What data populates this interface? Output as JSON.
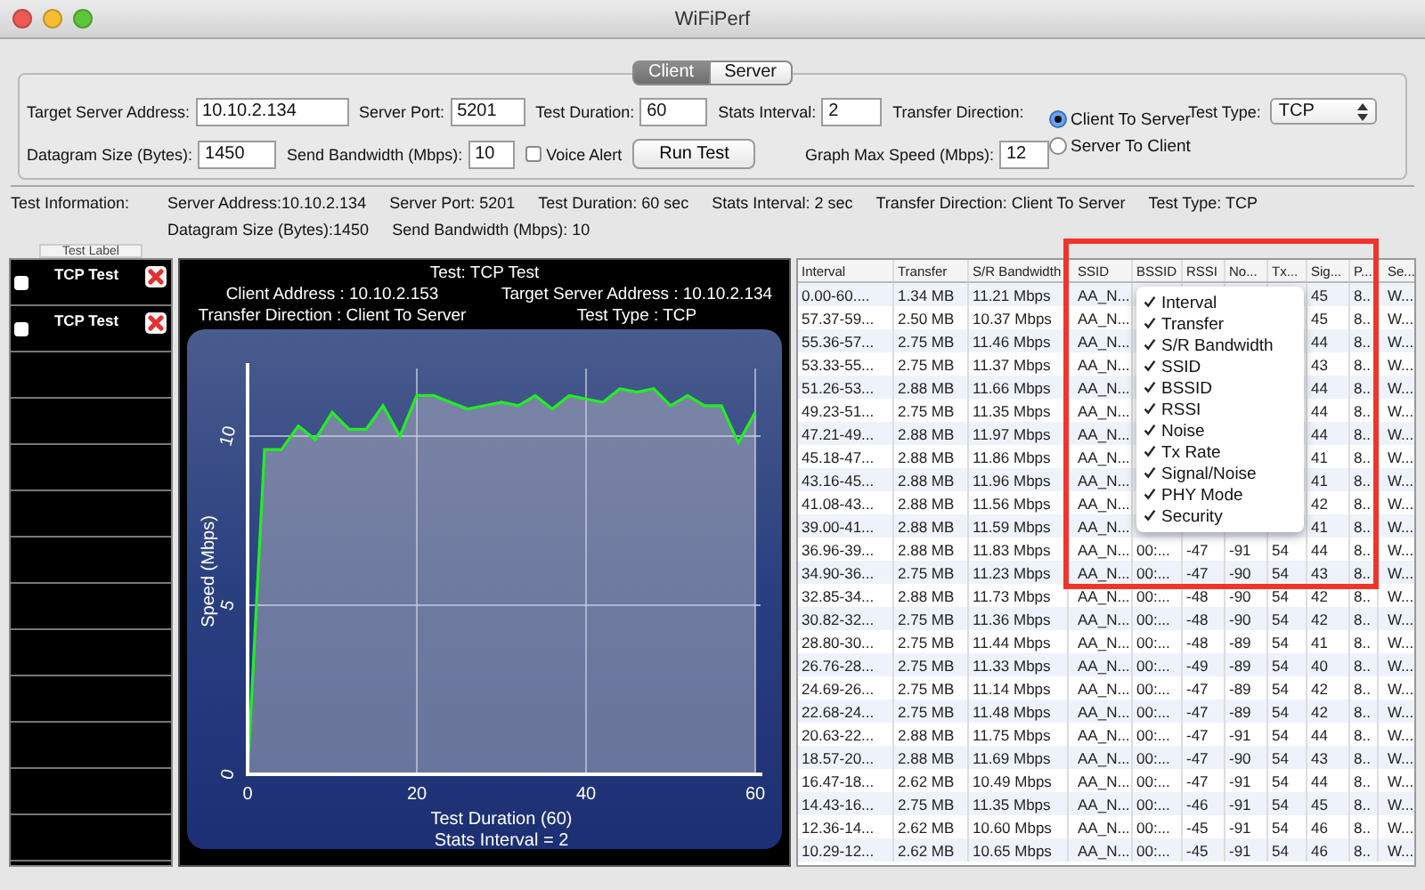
{
  "window": {
    "title": "WiFiPerf"
  },
  "tabs": [
    {
      "label": "Client",
      "selected": true
    },
    {
      "label": "Server",
      "selected": false
    }
  ],
  "form": {
    "row_1": [
      {
        "kind": "field",
        "label": "Target Server Address:",
        "value": "10.10.2.134"
      },
      {
        "kind": "field",
        "label": "Server Port:",
        "value": "5201"
      },
      {
        "kind": "field",
        "label": "Test Duration:",
        "value": "60"
      },
      {
        "kind": "field",
        "label": "Stats Interval:",
        "value": "2"
      }
    ],
    "transfer_direction": {
      "label": "Transfer Direction:",
      "options": [
        {
          "label": "Client To Server",
          "selected": true
        },
        {
          "label": "Server To Client",
          "selected": false
        }
      ]
    },
    "test_type": {
      "label": "Test Type:",
      "value": "TCP"
    },
    "row_2": [
      {
        "kind": "field",
        "label": "Datagram Size (Bytes):",
        "value": "1450"
      },
      {
        "kind": "field",
        "label": "Send Bandwidth (Mbps):",
        "value": "10"
      },
      {
        "kind": "checkbox",
        "label": "Voice Alert",
        "checked": false
      },
      {
        "kind": "button",
        "label": "Run Test"
      },
      {
        "kind": "field",
        "label": "Graph Max Speed (Mbps):",
        "value": "12"
      }
    ]
  },
  "test_information": {
    "label": "Test Information:",
    "lines": [
      [
        "Server Address:10.10.2.134",
        "Server Port: 5201",
        "Test Duration: 60 sec",
        "Stats Interval: 2 sec",
        "Transfer Direction: Client To Server",
        "Test Type: TCP"
      ],
      [
        "Datagram Size (Bytes):1450",
        "Send Bandwidth (Mbps): 10"
      ]
    ]
  },
  "tests": {
    "header": "Test Label",
    "items": [
      {
        "label": "TCP Test",
        "checked": false
      },
      {
        "label": "TCP Test",
        "checked": false
      }
    ]
  },
  "chart_header": {
    "title": "Test: TCP Test",
    "lines": [
      [
        "Client Address : 10.10.2.153",
        "Target Server Address : 10.10.2.134"
      ],
      [
        "Transfer Direction : Client To Server",
        "Test Type : TCP"
      ]
    ]
  },
  "chart_data": {
    "type": "line",
    "xlabel": "Test Duration (60)",
    "ylabel": "Speed (Mbps)",
    "annotations": [
      "Stats Interval = 2"
    ],
    "x": [
      0,
      2,
      4,
      6,
      8,
      10,
      12,
      14,
      16,
      18,
      20,
      22,
      24,
      26,
      28,
      30,
      32,
      34,
      36,
      38,
      40,
      42,
      44,
      46,
      48,
      50,
      52,
      54,
      56,
      58,
      60
    ],
    "series": [
      {
        "color": "#22ee22",
        "values": [
          0,
          9.6,
          9.6,
          10.3,
          9.9,
          10.7,
          10.2,
          10.2,
          10.9,
          10.0,
          11.2,
          11.2,
          11.0,
          10.8,
          10.9,
          11.0,
          10.9,
          11.2,
          10.8,
          11.2,
          11.1,
          11.0,
          11.4,
          11.3,
          11.4,
          10.9,
          11.2,
          10.9,
          10.9,
          9.8,
          10.7
        ]
      }
    ],
    "xlim": [
      0,
      60
    ],
    "ylim": [
      0,
      12
    ],
    "xticks": [
      0,
      20,
      40,
      60
    ],
    "yticks": [
      0,
      5,
      10
    ],
    "grid": true
  },
  "table": {
    "columns": [
      "Interval",
      "Transfer",
      "S/R Bandwidth",
      "SSID",
      "BSSID",
      "RSSI",
      "No...",
      "Tx...",
      "Sig...",
      "P...",
      "Se..."
    ],
    "rows": [
      [
        "0.00-60....",
        "1.34 MB",
        "11.21 Mbps",
        "AA_N...",
        null,
        null,
        null,
        null,
        "45",
        "8..",
        "W..."
      ],
      [
        "57.37-59...",
        "2.50 MB",
        "10.37 Mbps",
        "AA_N...",
        null,
        null,
        null,
        null,
        "45",
        "8..",
        "W..."
      ],
      [
        "55.36-57...",
        "2.75 MB",
        "11.46 Mbps",
        "AA_N...",
        null,
        null,
        null,
        null,
        "44",
        "8..",
        "W..."
      ],
      [
        "53.33-55...",
        "2.75 MB",
        "11.37 Mbps",
        "AA_N...",
        null,
        null,
        null,
        null,
        "43",
        "8..",
        "W..."
      ],
      [
        "51.26-53...",
        "2.88 MB",
        "11.66 Mbps",
        "AA_N...",
        null,
        null,
        null,
        null,
        "44",
        "8..",
        "W..."
      ],
      [
        "49.23-51...",
        "2.75 MB",
        "11.35 Mbps",
        "AA_N...",
        null,
        null,
        null,
        null,
        "44",
        "8..",
        "W..."
      ],
      [
        "47.21-49...",
        "2.88 MB",
        "11.97 Mbps",
        "AA_N...",
        null,
        null,
        null,
        null,
        "44",
        "8..",
        "W..."
      ],
      [
        "45.18-47...",
        "2.88 MB",
        "11.86 Mbps",
        "AA_N...",
        null,
        null,
        null,
        null,
        "41",
        "8..",
        "W..."
      ],
      [
        "43.16-45...",
        "2.88 MB",
        "11.96 Mbps",
        "AA_N...",
        null,
        null,
        null,
        null,
        "41",
        "8..",
        "W..."
      ],
      [
        "41.08-43...",
        "2.88 MB",
        "11.56 Mbps",
        "AA_N...",
        null,
        null,
        null,
        null,
        "42",
        "8..",
        "W..."
      ],
      [
        "39.00-41...",
        "2.88 MB",
        "11.59 Mbps",
        "AA_N...",
        null,
        null,
        null,
        null,
        "41",
        "8..",
        "W..."
      ],
      [
        "36.96-39...",
        "2.88 MB",
        "11.83 Mbps",
        "AA_N...",
        "00:...",
        "-47",
        "-91",
        "54",
        "44",
        "8..",
        "W..."
      ],
      [
        "34.90-36...",
        "2.75 MB",
        "11.23 Mbps",
        "AA_N...",
        "00:...",
        "-47",
        "-90",
        "54",
        "43",
        "8..",
        "W..."
      ],
      [
        "32.85-34...",
        "2.88 MB",
        "11.73 Mbps",
        "AA_N...",
        "00:...",
        "-48",
        "-90",
        "54",
        "42",
        "8..",
        "W..."
      ],
      [
        "30.82-32...",
        "2.75 MB",
        "11.36 Mbps",
        "AA_N...",
        "00:...",
        "-48",
        "-90",
        "54",
        "42",
        "8..",
        "W..."
      ],
      [
        "28.80-30...",
        "2.75 MB",
        "11.44 Mbps",
        "AA_N...",
        "00:...",
        "-48",
        "-89",
        "54",
        "41",
        "8..",
        "W..."
      ],
      [
        "26.76-28...",
        "2.75 MB",
        "11.33 Mbps",
        "AA_N...",
        "00:...",
        "-49",
        "-89",
        "54",
        "40",
        "8..",
        "W..."
      ],
      [
        "24.69-26...",
        "2.75 MB",
        "11.14 Mbps",
        "AA_N...",
        "00:...",
        "-47",
        "-89",
        "54",
        "42",
        "8..",
        "W..."
      ],
      [
        "22.68-24...",
        "2.75 MB",
        "11.48 Mbps",
        "AA_N...",
        "00:...",
        "-47",
        "-89",
        "54",
        "42",
        "8..",
        "W..."
      ],
      [
        "20.63-22...",
        "2.88 MB",
        "11.75 Mbps",
        "AA_N...",
        "00:...",
        "-47",
        "-91",
        "54",
        "44",
        "8..",
        "W..."
      ],
      [
        "18.57-20...",
        "2.88 MB",
        "11.69 Mbps",
        "AA_N...",
        "00:...",
        "-47",
        "-90",
        "54",
        "43",
        "8..",
        "W..."
      ],
      [
        "16.47-18...",
        "2.62 MB",
        "10.49 Mbps",
        "AA_N...",
        "00:...",
        "-47",
        "-91",
        "54",
        "44",
        "8..",
        "W..."
      ],
      [
        "14.43-16...",
        "2.75 MB",
        "11.35 Mbps",
        "AA_N...",
        "00:...",
        "-46",
        "-91",
        "54",
        "45",
        "8..",
        "W..."
      ],
      [
        "12.36-14...",
        "2.62 MB",
        "10.60 Mbps",
        "AA_N...",
        "00:...",
        "-45",
        "-91",
        "54",
        "46",
        "8..",
        "W..."
      ],
      [
        "10.29-12...",
        "2.62 MB",
        "10.65 Mbps",
        "AA_N...",
        "00:...",
        "-45",
        "-91",
        "54",
        "46",
        "8..",
        "W..."
      ]
    ]
  },
  "column_menu": [
    {
      "label": "Interval",
      "checked": true
    },
    {
      "label": "Transfer",
      "checked": true
    },
    {
      "label": "S/R Bandwidth",
      "checked": true
    },
    {
      "label": "SSID",
      "checked": true
    },
    {
      "label": "BSSID",
      "checked": true
    },
    {
      "label": "RSSI",
      "checked": true
    },
    {
      "label": "Noise",
      "checked": true
    },
    {
      "label": "Tx Rate",
      "checked": true
    },
    {
      "label": "Signal/Noise",
      "checked": true
    },
    {
      "label": "PHY Mode",
      "checked": true
    },
    {
      "label": "Security",
      "checked": true
    }
  ]
}
